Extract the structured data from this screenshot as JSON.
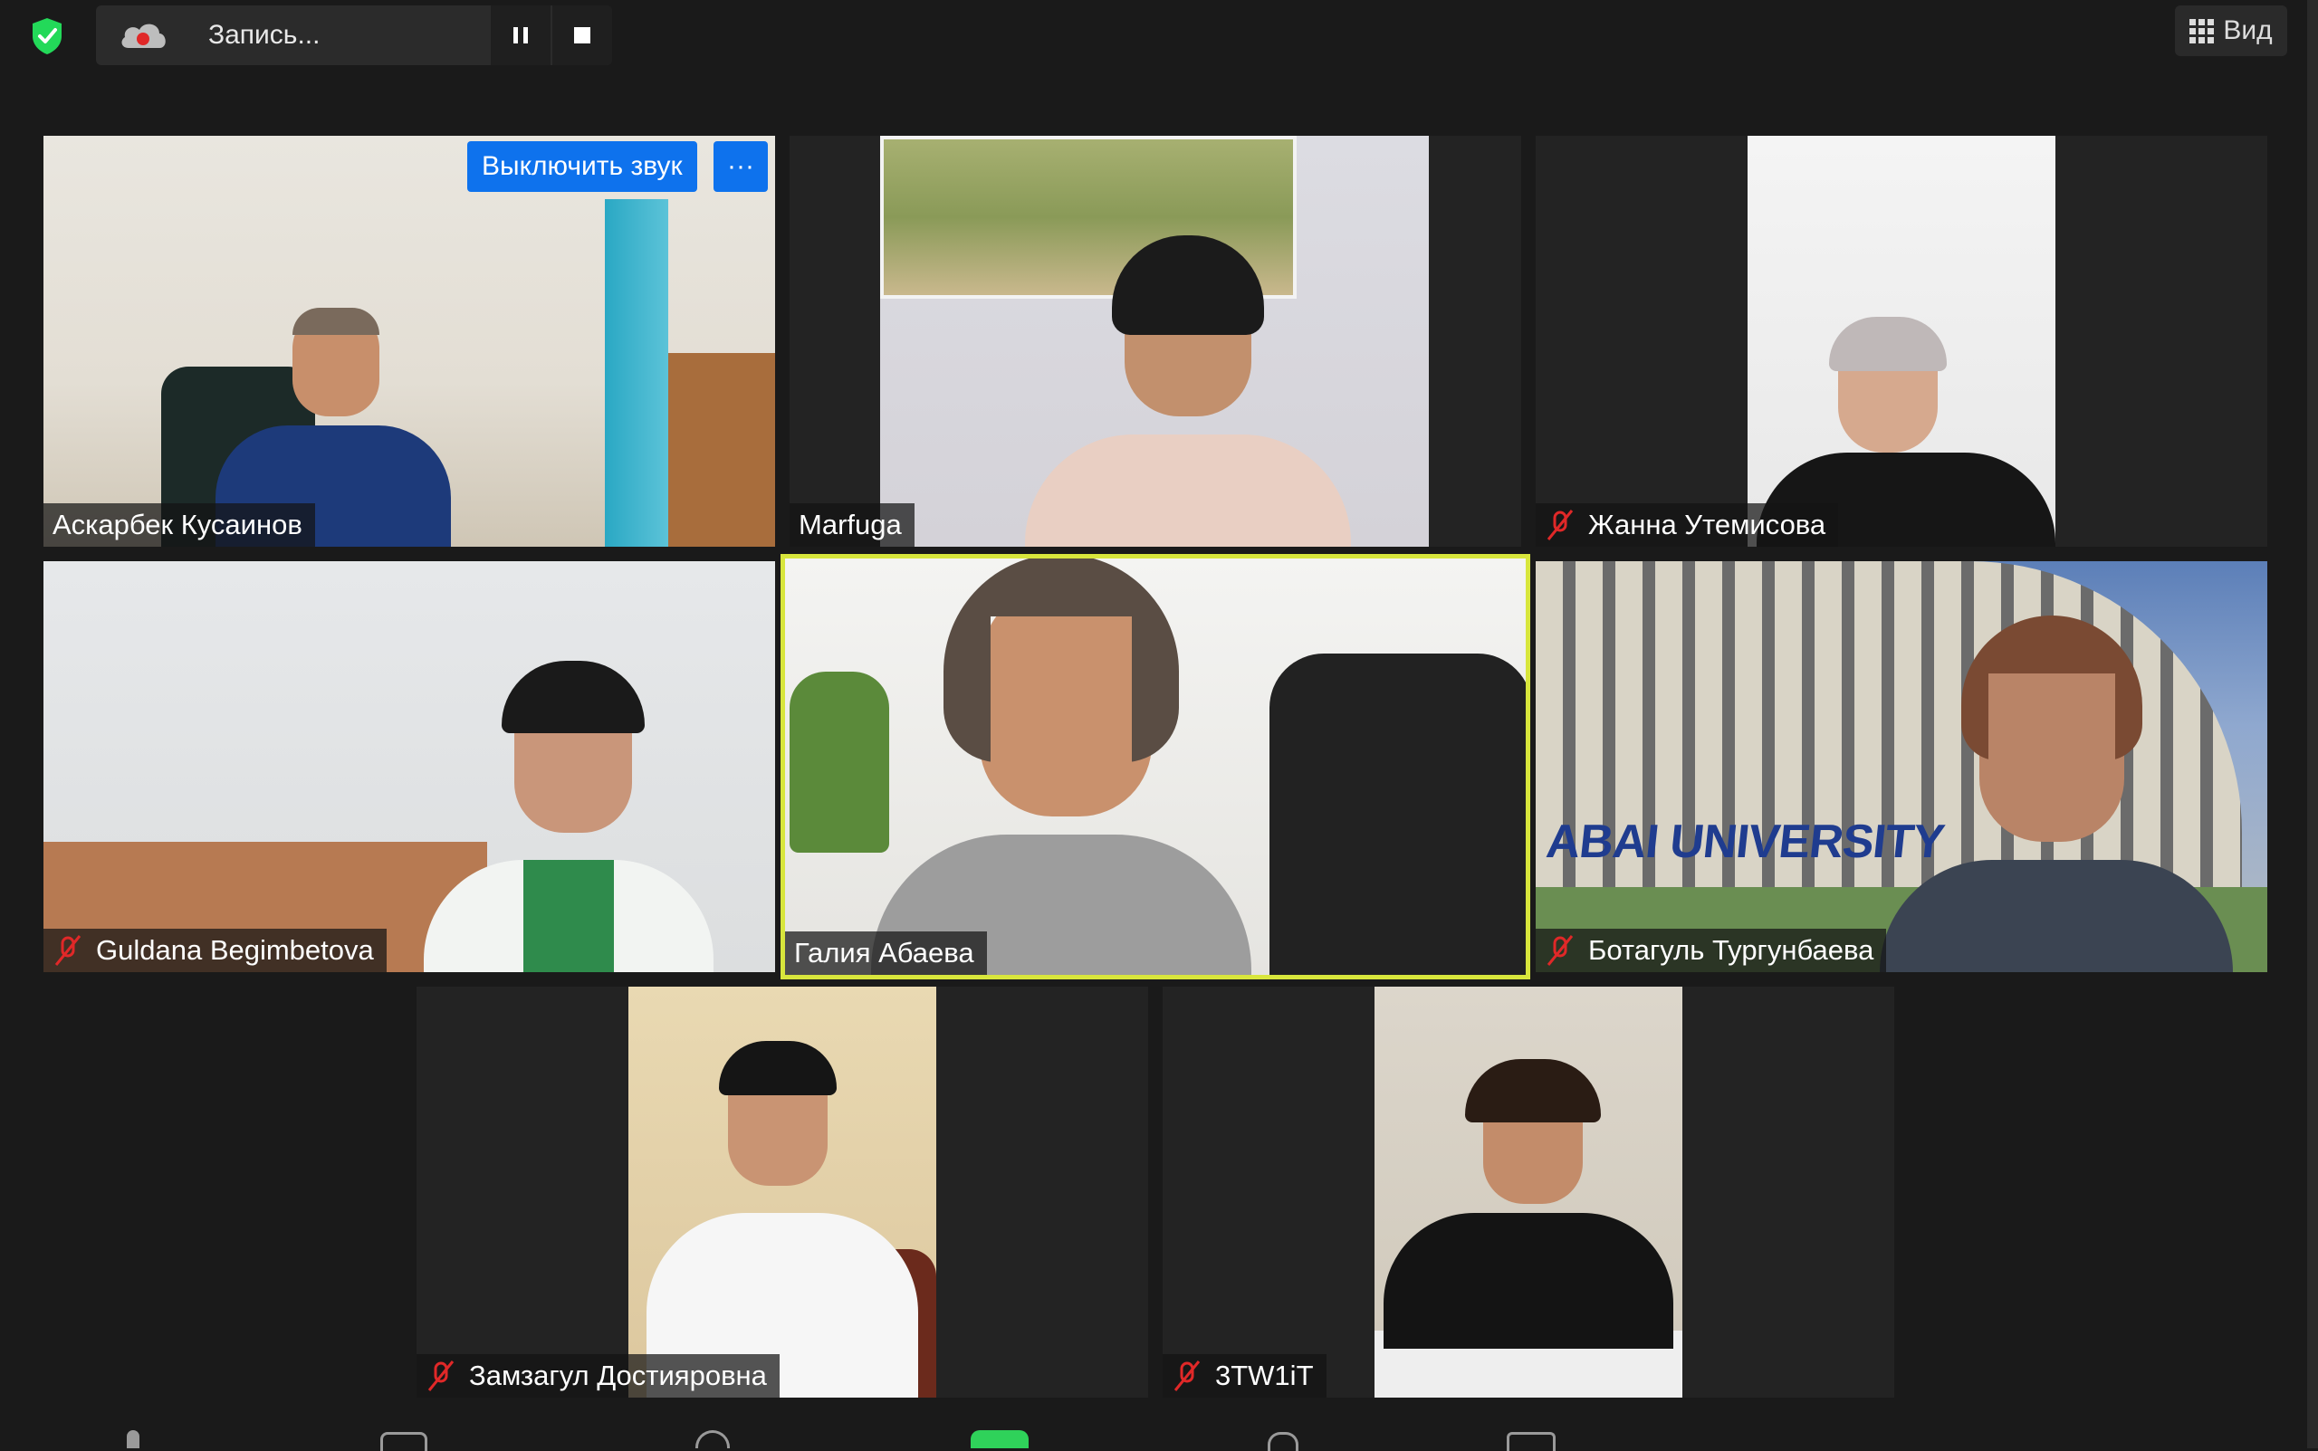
{
  "top": {
    "record_label": "Запись...",
    "view_label": "Вид"
  },
  "tiles": [
    {
      "name": "Аскарбек Кусаинов",
      "muted": false
    },
    {
      "name": "Marfuga",
      "muted": false
    },
    {
      "name": "Жанна Утемисова",
      "muted": true
    },
    {
      "name": "Guldana Begimbetova",
      "muted": true
    },
    {
      "name": "Галия Абаева",
      "muted": false,
      "active_speaker": true
    },
    {
      "name": "Ботагуль Тургунбаева",
      "muted": true
    },
    {
      "name": "Замзагул Достияровна",
      "muted": true
    },
    {
      "name": "3TW1iT",
      "muted": true
    }
  ],
  "hover_controls": {
    "mute_label": "Выключить звук",
    "more_label": "···"
  },
  "background_signs": {
    "university": "ABAI UNIVERSITY"
  },
  "colors": {
    "accent_blue": "#0e72ed",
    "speaker_border": "#d8e63c",
    "mute_red": "#e02828",
    "shield_green": "#23d959"
  }
}
